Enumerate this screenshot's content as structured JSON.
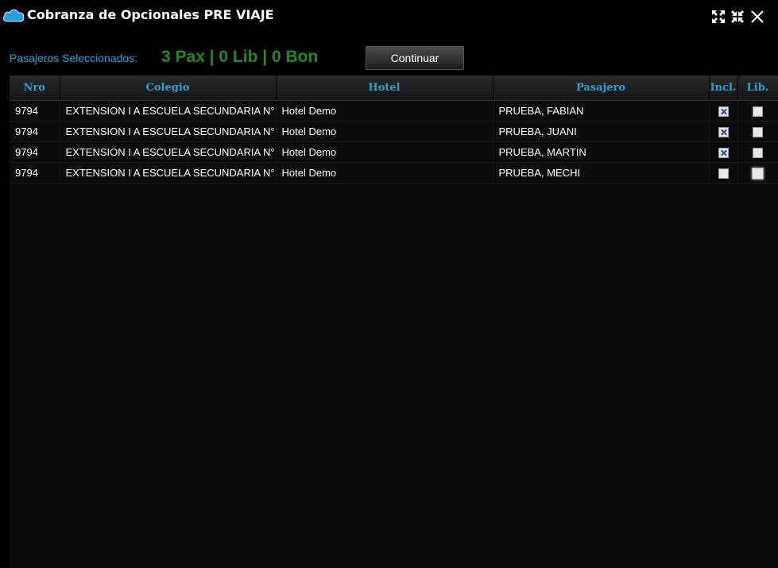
{
  "window": {
    "title": "Cobranza de Opcionales PRE VIAJE",
    "icon": "cloud-icon",
    "controls": [
      "collapse-icon",
      "expand-icon",
      "close-icon"
    ]
  },
  "summary": {
    "label": "Pasajeros Seleccionados:",
    "counts": "3 Pax | 0 Lib | 0 Bon",
    "continue_label": "Continuar"
  },
  "table": {
    "columns": [
      "Nro",
      "Colegio",
      "Hotel",
      "Pasajero",
      "Incl.",
      "Lib."
    ],
    "rows": [
      {
        "nro": "9794",
        "colegio": "EXTENSION I A ESCUELA SECUNDARIA N°",
        "hotel": "Hotel Demo",
        "pasajero": "PRUEBA, FABIAN",
        "incl": true,
        "lib": false
      },
      {
        "nro": "9794",
        "colegio": "EXTENSION I A ESCUELA SECUNDARIA N°",
        "hotel": "Hotel Demo",
        "pasajero": "PRUEBA, JUANI",
        "incl": true,
        "lib": false
      },
      {
        "nro": "9794",
        "colegio": "EXTENSION I A ESCUELA SECUNDARIA N°",
        "hotel": "Hotel Demo",
        "pasajero": "PRUEBA, MARTIN",
        "incl": true,
        "lib": false
      },
      {
        "nro": "9794",
        "colegio": "EXTENSION I A ESCUELA SECUNDARIA N°",
        "hotel": "Hotel Demo",
        "pasajero": "PRUEBA, MECHI",
        "incl": false,
        "lib": false
      }
    ]
  },
  "colors": {
    "accent": "#2ba3d6",
    "counts": "#1f8a1f",
    "background": "#000000",
    "check": "#2b3fa8"
  }
}
